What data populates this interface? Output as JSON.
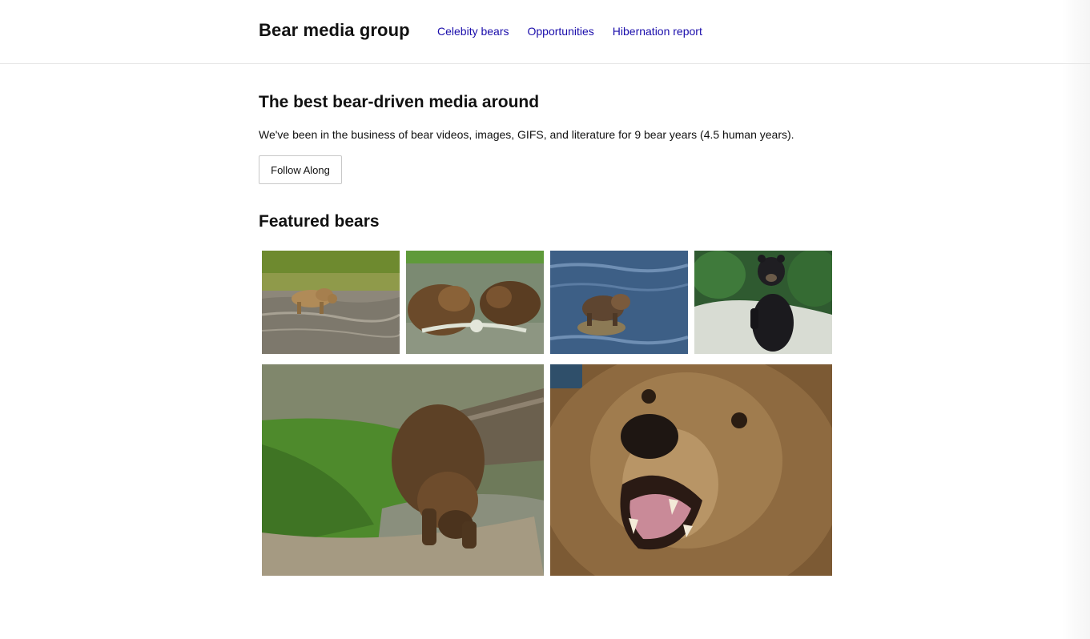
{
  "header": {
    "brand": "Bear media group",
    "nav": [
      {
        "label": "Celebity bears"
      },
      {
        "label": "Opportunities"
      },
      {
        "label": "Hibernation report"
      }
    ]
  },
  "hero": {
    "title": "The best bear-driven media around",
    "text": "We've been in the business of bear videos, images, GIFS, and literature for 9 bear years (4.5 human years).",
    "button_label": "Follow Along"
  },
  "featured": {
    "title": "Featured bears",
    "photos": [
      {
        "subject": "brown bear wading in stream near grassy bank"
      },
      {
        "subject": "two brown bears wrestling in water"
      },
      {
        "subject": "brown bear standing on rock in blue river"
      },
      {
        "subject": "black bear sitting upright on rock with forest behind"
      },
      {
        "subject": "brown bear drinking at water's edge by log"
      },
      {
        "subject": "close-up of roaring brown bear face"
      }
    ]
  },
  "colors": {
    "link": "#1a0dab",
    "text": "#111111",
    "border": "#e6e6e6"
  }
}
